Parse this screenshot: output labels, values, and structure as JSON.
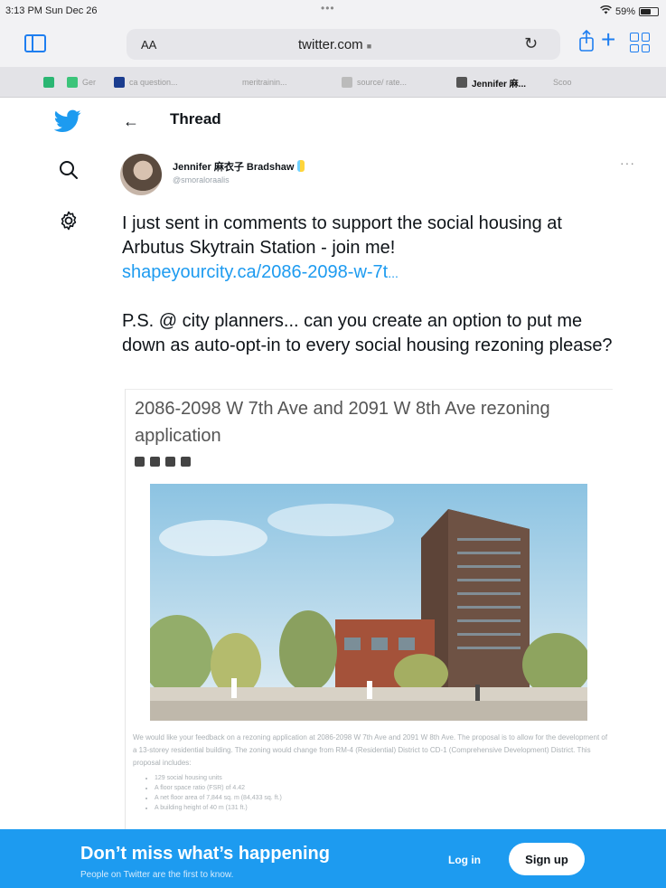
{
  "status_bar": {
    "time_date": "3:13 PM  Sun Dec 26",
    "battery": "59%",
    "battery_level": 0.59
  },
  "browser": {
    "text_size_label": "AA",
    "url": "twitter.com",
    "icons": [
      "sidebar-icon",
      "reload-icon",
      "share-icon",
      "plus-icon",
      "tabs-icon"
    ],
    "tabs": [
      {
        "label": "",
        "color": "#2bb673"
      },
      {
        "label": "Ger",
        "color": "#3cc47a"
      },
      {
        "label": "ca question...",
        "color": "#1b3d8f"
      },
      {
        "label": "meritrainin...",
        "color": "#bbbbbb"
      },
      {
        "label": "source/ rate...",
        "color": "#bbbbbb"
      },
      {
        "label": "Jennifer 麻...",
        "color": "#555555"
      },
      {
        "label": "Scoo",
        "color": "#cccccc"
      }
    ]
  },
  "twitter": {
    "brand_color": "#1d9bf0",
    "thread_title": "Thread",
    "author": {
      "name": "Jennifer 麻衣子 Bradshaw",
      "handle": "@smoraloraalis"
    },
    "tweet": {
      "paragraph1": "I just sent in comments to support the social housing at Arbutus Skytrain Station - join me!",
      "link": "shapeyourcity.ca/2086-2098-w-7t",
      "link_suffix": "...",
      "paragraph2": "P.S. @ city planners... can you create an option to put me down as auto-opt-in to every social housing rezoning please?"
    },
    "card": {
      "title": "2086-2098 W 7th Ave and 2091 W 8th Ave rezoning application",
      "description": "We would like your feedback on a rezoning application at 2086-2098 W 7th Ave and 2091 W 8th Ave. The proposal is to allow for the development of a 13-storey residential building. The zoning would change from RM-4 (Residential) District to CD-1 (Comprehensive Development) District. This proposal includes:",
      "bullets": [
        "129 social housing units",
        "A floor space ratio (FSR) of 4.42",
        "A net floor area of 7,844 sq. m (84,433 sq. ft.)",
        "A building height of 40 m (131 ft.)"
      ]
    },
    "banner": {
      "title": "Don’t miss what’s happening",
      "subtitle": "People on Twitter are the first to know.",
      "login_label": "Log in",
      "signup_label": "Sign up"
    }
  }
}
